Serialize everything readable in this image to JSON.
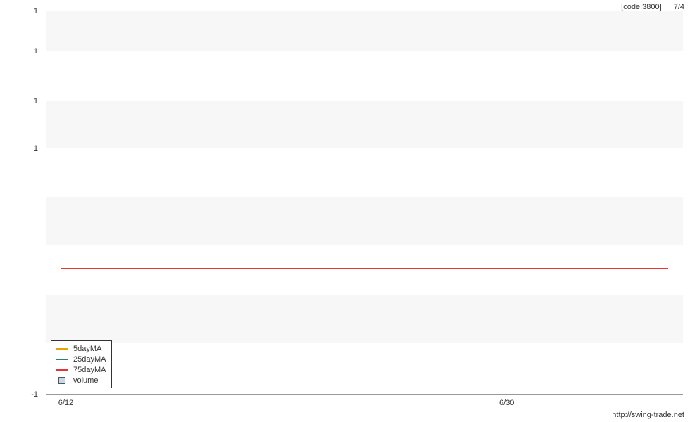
{
  "header": {
    "code_label": "[code:3800]",
    "date_partial": "7/4"
  },
  "footer": {
    "url": "http://swing-trade.net"
  },
  "legend": {
    "items": [
      {
        "label": "5dayMA",
        "color": "#e5a400",
        "kind": "line"
      },
      {
        "label": "25dayMA",
        "color": "#1a8a6a",
        "kind": "line"
      },
      {
        "label": "75dayMA",
        "color": "#e33333",
        "kind": "line"
      },
      {
        "label": "volume",
        "color": "#c9d8e8",
        "kind": "box"
      }
    ]
  },
  "axes": {
    "y_ticks": [
      {
        "label": "1",
        "pos_pct": 0
      },
      {
        "label": "1",
        "pos_pct": 10.5
      },
      {
        "label": "1",
        "pos_pct": 23.5
      },
      {
        "label": "1",
        "pos_pct": 35.8
      },
      {
        "label": "-1",
        "pos_pct": 100
      }
    ],
    "x_ticks": [
      {
        "label": "6/12",
        "pos_pct": 2.2
      },
      {
        "label": "6/30",
        "pos_pct": 71.4
      }
    ]
  },
  "chart_data": {
    "type": "line",
    "title": "",
    "xlabel": "",
    "ylabel": "",
    "ylim": [
      -1,
      1
    ],
    "x_categories": [
      "6/12",
      "6/30"
    ],
    "series": [
      {
        "name": "5dayMA",
        "values": []
      },
      {
        "name": "25dayMA",
        "values": []
      },
      {
        "name": "75dayMA",
        "values": [
          0,
          0
        ]
      },
      {
        "name": "volume",
        "values": []
      }
    ],
    "annotations": {
      "code": "3800"
    }
  }
}
